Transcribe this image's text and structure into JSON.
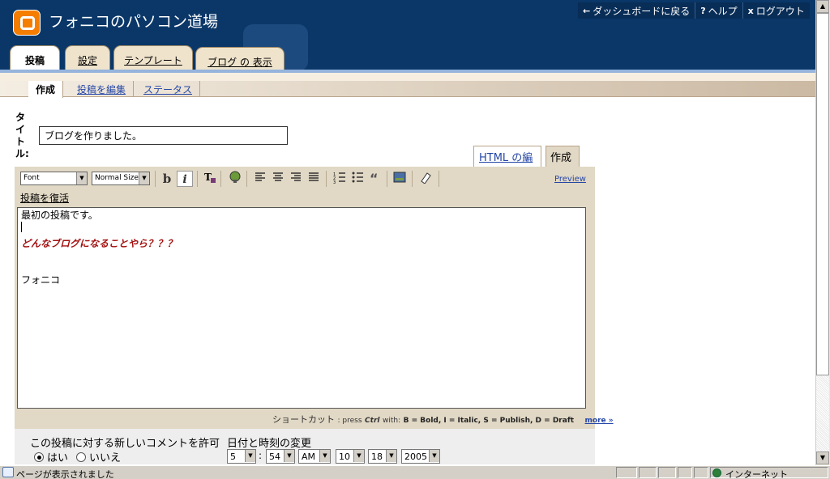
{
  "header": {
    "blog_title": "フォニコのパソコン道場",
    "nav": [
      {
        "icon": "←",
        "label": "ダッシュボードに戻る"
      },
      {
        "icon": "?",
        "label": "ヘルプ"
      },
      {
        "icon": "x",
        "label": "ログアウト"
      }
    ]
  },
  "tabs": [
    "投稿",
    "設定",
    "テンプレート",
    "ブログ の 表示"
  ],
  "subtabs": [
    "作成",
    "投稿を編集",
    "ステータス"
  ],
  "post": {
    "title_label": "タイトル:",
    "title_value": "ブログを作りました。",
    "html_tab": "HTML の編集",
    "compose_tab": "作成",
    "recover": "投稿を復活",
    "body_lines": [
      "最初の投稿です。",
      "どんなブログになることやら？？？",
      "フォニコ"
    ]
  },
  "toolbar": {
    "font": "Font",
    "size": "Normal Size",
    "bold": "b",
    "italic": "i",
    "preview": "Preview",
    "icons": [
      "bold-icon",
      "italic-icon",
      "text-color-icon",
      "link-icon",
      "align-left-icon",
      "align-center-icon",
      "align-right-icon",
      "justify-icon",
      "numbered-list-icon",
      "bullet-list-icon",
      "blockquote-icon",
      "image-icon",
      "eraser-icon"
    ]
  },
  "shortcut": {
    "label": "ショートカット",
    "text": ": press",
    "ctrl": "Ctrl",
    "with": "with:",
    "keys": "B = Bold,  I = Italic,  S = Publish,  D = Draft",
    "more": "more »"
  },
  "comments": {
    "label": "この投稿に対する新しいコメントを許可",
    "yes": "はい",
    "no": "いいえ",
    "selected": "yes"
  },
  "datetime": {
    "label": "日付と時刻の変更",
    "hour": "5",
    "colon": ":",
    "minute": "54",
    "ampm": "AM",
    "month": "10",
    "day": "18",
    "year": "2005"
  },
  "statusbar": {
    "text": "ページが表示されました",
    "zone": "インターネット"
  }
}
